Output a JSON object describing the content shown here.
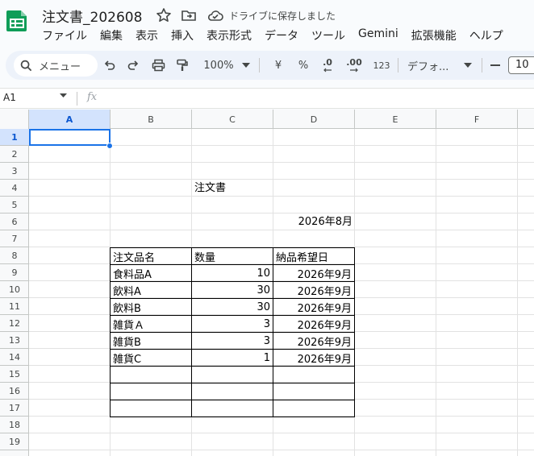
{
  "title_bar": {
    "doc_title": "注文書_202608",
    "save_status": "ドライブに保存しました"
  },
  "menu": [
    "ファイル",
    "編集",
    "表示",
    "挿入",
    "表示形式",
    "データ",
    "ツール",
    "Gemini",
    "拡張機能",
    "ヘルプ"
  ],
  "toolbar": {
    "search_label": "メニュー",
    "zoom": "100%",
    "currency": "¥",
    "percent": "%",
    "dec_decrease": ".0",
    "dec_increase": ".00",
    "number_format": "123",
    "font_name": "デフォ...",
    "font_size": "10"
  },
  "formula_bar": {
    "name_box": "A1",
    "fx": "fx"
  },
  "grid": {
    "columns": [
      "A",
      "B",
      "C",
      "D",
      "E",
      "F"
    ],
    "rows": [
      "1",
      "2",
      "3",
      "4",
      "5",
      "6",
      "7",
      "8",
      "9",
      "10",
      "11",
      "12",
      "13",
      "14",
      "15",
      "16",
      "17",
      "18",
      "19"
    ],
    "active_cell": "A1",
    "c4": "注文書",
    "d6": "2026年8月",
    "table": {
      "headers": [
        "注文品名",
        "数量",
        "納品希望日"
      ],
      "rows": [
        [
          "食料品A",
          "10",
          "2026年9月"
        ],
        [
          "飲料A",
          "30",
          "2026年9月"
        ],
        [
          "飲料B",
          "30",
          "2026年9月"
        ],
        [
          "雑貨Ａ",
          "3",
          "2026年9月"
        ],
        [
          "雑貨B",
          "3",
          "2026年9月"
        ],
        [
          "雑貨C",
          "1",
          "2026年9月"
        ],
        [
          "",
          "",
          ""
        ],
        [
          "",
          "",
          ""
        ],
        [
          "",
          "",
          ""
        ]
      ]
    }
  },
  "colors": {
    "accent": "#1a73e8",
    "toolbar_bg": "#edf2fa",
    "logo_green": "#0f9d58"
  }
}
